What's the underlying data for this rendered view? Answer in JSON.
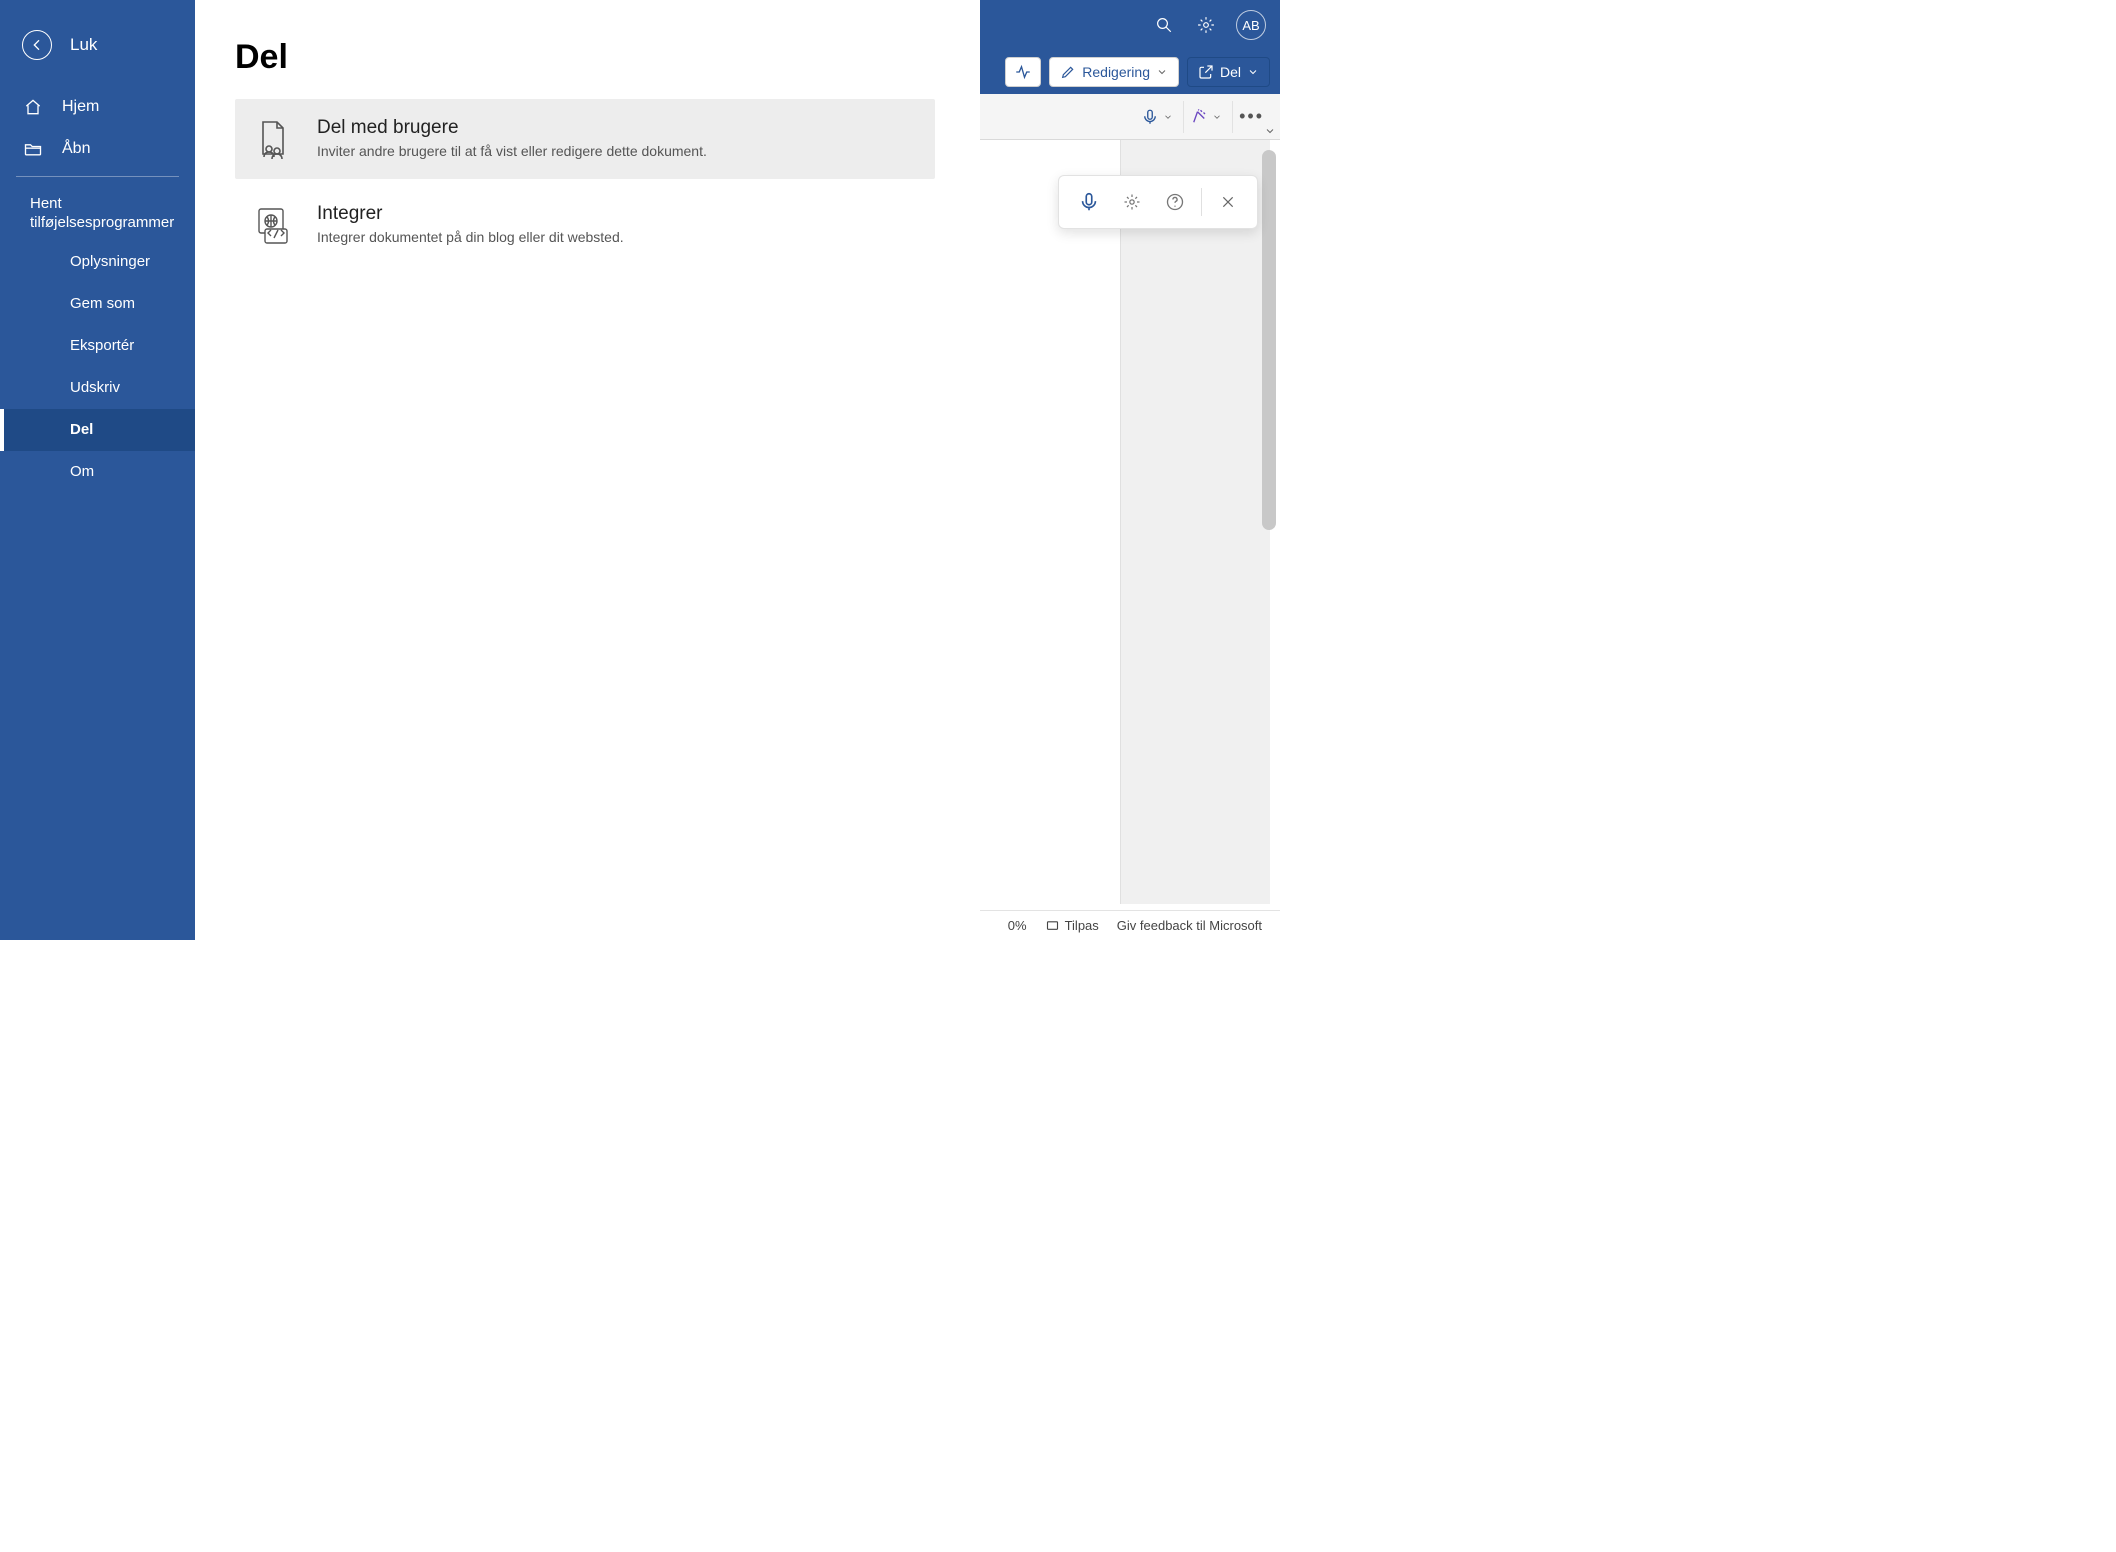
{
  "title_bar": {
    "user_initials": "AB"
  },
  "cmd_row": {
    "editing_label": "Redigering",
    "share_label": "Del"
  },
  "status_bar": {
    "zoom_text": "0%",
    "fit_label": "Tilpas",
    "feedback_label": "Giv feedback til Microsoft"
  },
  "backstage": {
    "close_label": "Luk",
    "page_title": "Del",
    "nav": {
      "home": "Hjem",
      "open": "Åbn",
      "addins": "Hent tilføjelsesprogrammer",
      "info": "Oplysninger",
      "saveas": "Gem som",
      "export": "Eksportér",
      "print": "Udskriv",
      "share": "Del",
      "about": "Om"
    },
    "options": [
      {
        "title": "Del med brugere",
        "desc": "Inviter andre brugere til at få vist eller redigere dette dokument."
      },
      {
        "title": "Integrer",
        "desc": "Integrer dokumentet på din blog eller dit websted."
      }
    ]
  }
}
